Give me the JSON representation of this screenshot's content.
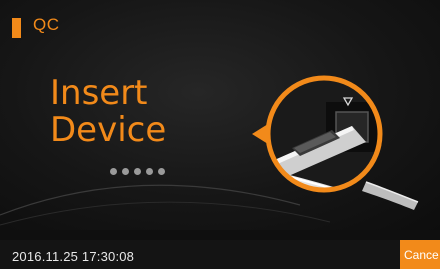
{
  "header": {
    "title": "QC"
  },
  "main": {
    "instruction_line1": "Insert",
    "instruction_line2": "Device",
    "progress_dots": 5,
    "illustration": "device-insertion-icon"
  },
  "footer": {
    "datetime": "2016.11.25  17:30:08",
    "cancel_label": "Cance"
  },
  "colors": {
    "accent": "#f28a1a",
    "background": "#111111",
    "dots": "#9a9a9a",
    "text": "#e8e8e8"
  }
}
